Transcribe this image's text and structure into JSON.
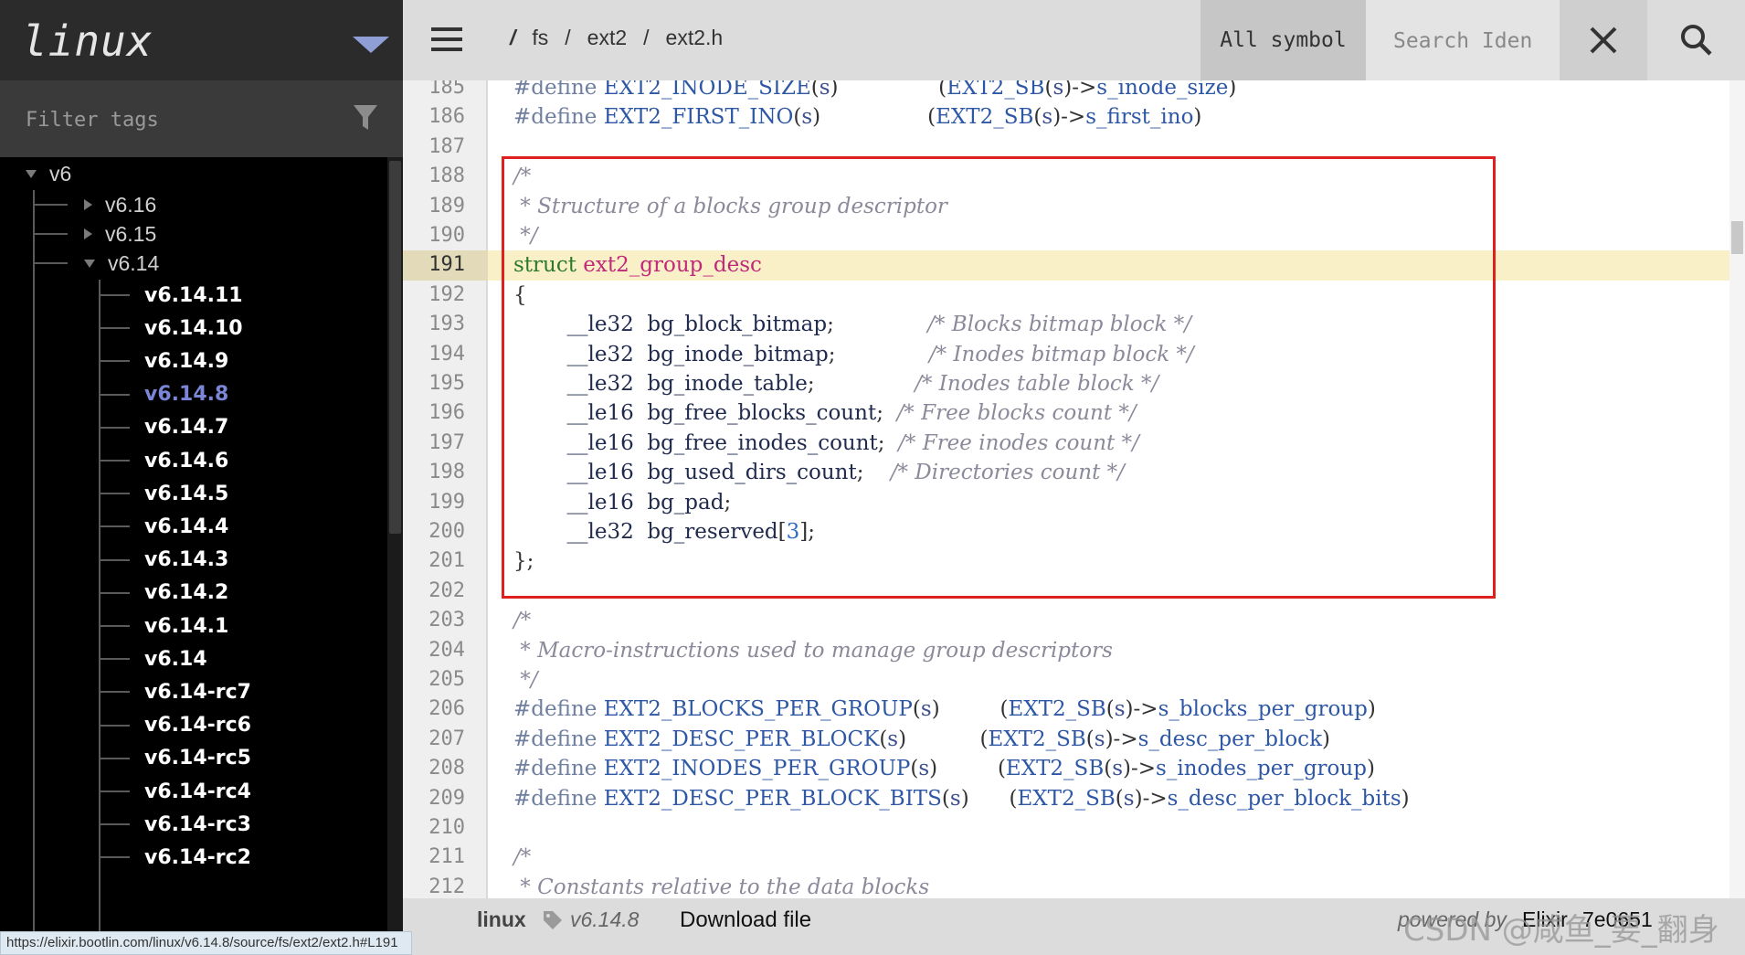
{
  "brand": {
    "title": "linux"
  },
  "filter": {
    "placeholder": "Filter tags"
  },
  "tree": {
    "root": "v6",
    "collapsed": [
      "v6.16",
      "v6.15"
    ],
    "expanded": "v6.14",
    "leaves": [
      "v6.14.11",
      "v6.14.10",
      "v6.14.9",
      "v6.14.8",
      "v6.14.7",
      "v6.14.6",
      "v6.14.5",
      "v6.14.4",
      "v6.14.3",
      "v6.14.2",
      "v6.14.1",
      "v6.14",
      "v6.14-rc7",
      "v6.14-rc6",
      "v6.14-rc5",
      "v6.14-rc4",
      "v6.14-rc3",
      "v6.14-rc2"
    ],
    "active": "v6.14.8"
  },
  "breadcrumb": {
    "root": "/",
    "parts": [
      "fs",
      "ext2",
      "ext2.h"
    ],
    "sep": "/"
  },
  "symbol_filter": {
    "label": "All symbol"
  },
  "search": {
    "placeholder": "Search Iden"
  },
  "code": {
    "highlight_line": 191,
    "lines": [
      {
        "n": 185,
        "html": "<span class=\"pp\">#define</span> <span class=\"mac\">EXT2_INODE_SIZE</span>(<span class=\"id\">s</span>)               (<span class=\"mac\">EXT2_SB</span>(<span class=\"id\">s</span>)-&gt;<span class=\"link\">s_inode_size</span>)"
      },
      {
        "n": 186,
        "html": "<span class=\"pp\">#define</span> <span class=\"mac\">EXT2_FIRST_INO</span>(<span class=\"id\">s</span>)                (<span class=\"mac\">EXT2_SB</span>(<span class=\"id\">s</span>)-&gt;<span class=\"link\">s_first_ino</span>)"
      },
      {
        "n": 187,
        "html": ""
      },
      {
        "n": 188,
        "html": "<span class=\"cm\">/*</span>"
      },
      {
        "n": 189,
        "html": "<span class=\"cm\"> * Structure of a blocks group descriptor</span>"
      },
      {
        "n": 190,
        "html": "<span class=\"cm\"> */</span>"
      },
      {
        "n": 191,
        "html": "<span class=\"st\">struct</span> <span class=\"fn\">ext2_group_desc</span>"
      },
      {
        "n": 192,
        "html": "{"
      },
      {
        "n": 193,
        "html": "        <span class=\"ty\">__le32</span>  <span class=\"field\">bg_block_bitmap</span>;              <span class=\"cm\">/* Blocks bitmap block */</span>"
      },
      {
        "n": 194,
        "html": "        <span class=\"ty\">__le32</span>  <span class=\"field\">bg_inode_bitmap</span>;              <span class=\"cm\">/* Inodes bitmap block */</span>"
      },
      {
        "n": 195,
        "html": "        <span class=\"ty\">__le32</span>  <span class=\"field\">bg_inode_table</span>;               <span class=\"cm\">/* Inodes table block */</span>"
      },
      {
        "n": 196,
        "html": "        <span class=\"ty\">__le16</span>  <span class=\"field\">bg_free_blocks_count</span>;  <span class=\"cm\">/* Free blocks count */</span>"
      },
      {
        "n": 197,
        "html": "        <span class=\"ty\">__le16</span>  <span class=\"field\">bg_free_inodes_count</span>;  <span class=\"cm\">/* Free inodes count */</span>"
      },
      {
        "n": 198,
        "html": "        <span class=\"ty\">__le16</span>  <span class=\"field\">bg_used_dirs_count</span>;    <span class=\"cm\">/* Directories count */</span>"
      },
      {
        "n": 199,
        "html": "        <span class=\"ty\">__le16</span>  <span class=\"field\">bg_pad</span>;"
      },
      {
        "n": 200,
        "html": "        <span class=\"ty\">__le32</span>  <span class=\"field\">bg_reserved</span>[<span class=\"num\">3</span>];"
      },
      {
        "n": 201,
        "html": "};"
      },
      {
        "n": 202,
        "html": ""
      },
      {
        "n": 203,
        "html": "<span class=\"cm\">/*</span>"
      },
      {
        "n": 204,
        "html": "<span class=\"cm\"> * Macro-instructions used to manage group descriptors</span>"
      },
      {
        "n": 205,
        "html": "<span class=\"cm\"> */</span>"
      },
      {
        "n": 206,
        "html": "<span class=\"pp\">#define</span> <span class=\"mac\">EXT2_BLOCKS_PER_GROUP</span>(<span class=\"id\">s</span>)         (<span class=\"mac\">EXT2_SB</span>(<span class=\"id\">s</span>)-&gt;<span class=\"link\">s_blocks_per_group</span>)"
      },
      {
        "n": 207,
        "html": "<span class=\"pp\">#define</span> <span class=\"mac\">EXT2_DESC_PER_BLOCK</span>(<span class=\"id\">s</span>)           (<span class=\"mac\">EXT2_SB</span>(<span class=\"id\">s</span>)-&gt;<span class=\"link\">s_desc_per_block</span>)"
      },
      {
        "n": 208,
        "html": "<span class=\"pp\">#define</span> <span class=\"mac\">EXT2_INODES_PER_GROUP</span>(<span class=\"id\">s</span>)         (<span class=\"mac\">EXT2_SB</span>(<span class=\"id\">s</span>)-&gt;<span class=\"link\">s_inodes_per_group</span>)"
      },
      {
        "n": 209,
        "html": "<span class=\"pp\">#define</span> <span class=\"mac\">EXT2_DESC_PER_BLOCK_BITS</span>(<span class=\"id\">s</span>)      (<span class=\"mac\">EXT2_SB</span>(<span class=\"id\">s</span>)-&gt;<span class=\"link\">s_desc_per_block_bits</span>)"
      },
      {
        "n": 210,
        "html": ""
      },
      {
        "n": 211,
        "html": "<span class=\"cm\">/*</span>"
      },
      {
        "n": 212,
        "html": "<span class=\"cm\"> * Constants relative to the data blocks</span>"
      }
    ]
  },
  "footer": {
    "project": "linux",
    "version": "v6.14.8",
    "download": "Download file",
    "powered": "powered by",
    "engine": "Elixir",
    "commit": "7e0651",
    "watermark": "CSDN @咸鱼_要_翻身"
  },
  "statusbar": {
    "url": "https://elixir.bootlin.com/linux/v6.14.8/source/fs/ext2/ext2.h#L191"
  },
  "colors": {
    "highlight": "#faf0c8",
    "accent": "#7b86d6",
    "annotation": "#e0201f"
  },
  "icons": [
    "hamburger-icon",
    "caret-down-icon",
    "filter-icon",
    "close-icon",
    "search-icon",
    "tag-icon"
  ]
}
